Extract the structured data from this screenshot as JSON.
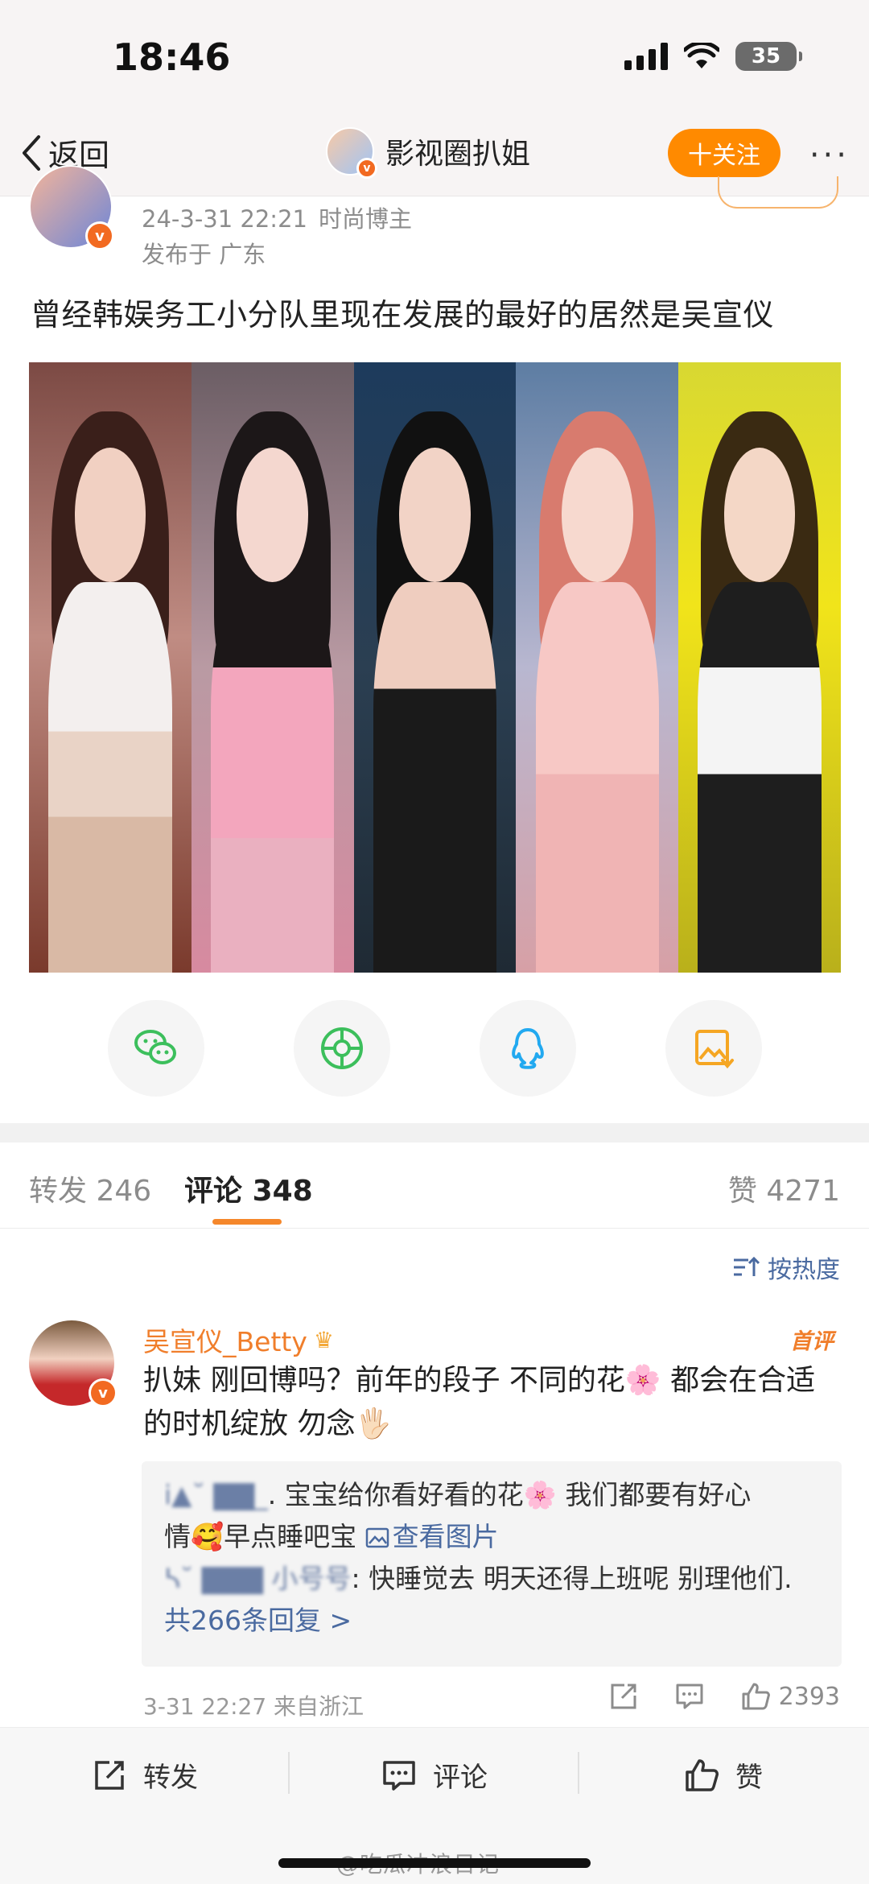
{
  "status_bar": {
    "time": "18:46",
    "battery": "35"
  },
  "nav": {
    "back_label": "返回",
    "account_name": "影视圈扒姐",
    "follow_label": "十关注",
    "more_label": "···"
  },
  "post": {
    "timestamp": "24-3-31 22:21",
    "tag": "时尚博主",
    "location": "发布于 广东",
    "text": "曾经韩娱务工小分队里现在发展的最好的居然是吴宣仪",
    "photo_count": 5
  },
  "share": {
    "icons": [
      "wechat-icon",
      "moments-icon",
      "qq-icon",
      "save-image-icon"
    ]
  },
  "tabs": {
    "repost_label": "转发",
    "repost_count": "246",
    "comment_label": "评论",
    "comment_count": "348",
    "like_label": "赞",
    "like_count": "4271"
  },
  "sort": {
    "label": "按热度"
  },
  "comment": {
    "author": "吴宣仪_Betty",
    "first_badge": "首评",
    "text": "扒妹 刚回博吗？前年的段子  不同的花🌸 都会在合适的时机绽放 勿念🖐🏻",
    "replies": [
      {
        "name": "i▲˘  ▇▇_",
        "text_a": ". 宝宝给你看好看的花🌸 我们都要有好心",
        "text_b": "情🥰早点睡吧宝 ",
        "view_image": "查看图片"
      },
      {
        "name": "ᓴ˘ ▇▇▇ 小号号",
        "text": ": 快睡觉去 明天还得上班呢 别理他们."
      }
    ],
    "more_replies": "共266条回复 >",
    "footer": "3-31 22:27  来自浙江",
    "like_count": "2393"
  },
  "bottom_bar": {
    "repost": "转发",
    "comment": "评论",
    "like": "赞"
  },
  "watermark": "@吃瓜冲浪日记",
  "colors": {
    "accent": "#ff8a00",
    "link": "#4a6aa0",
    "name": "#f07e2b"
  }
}
